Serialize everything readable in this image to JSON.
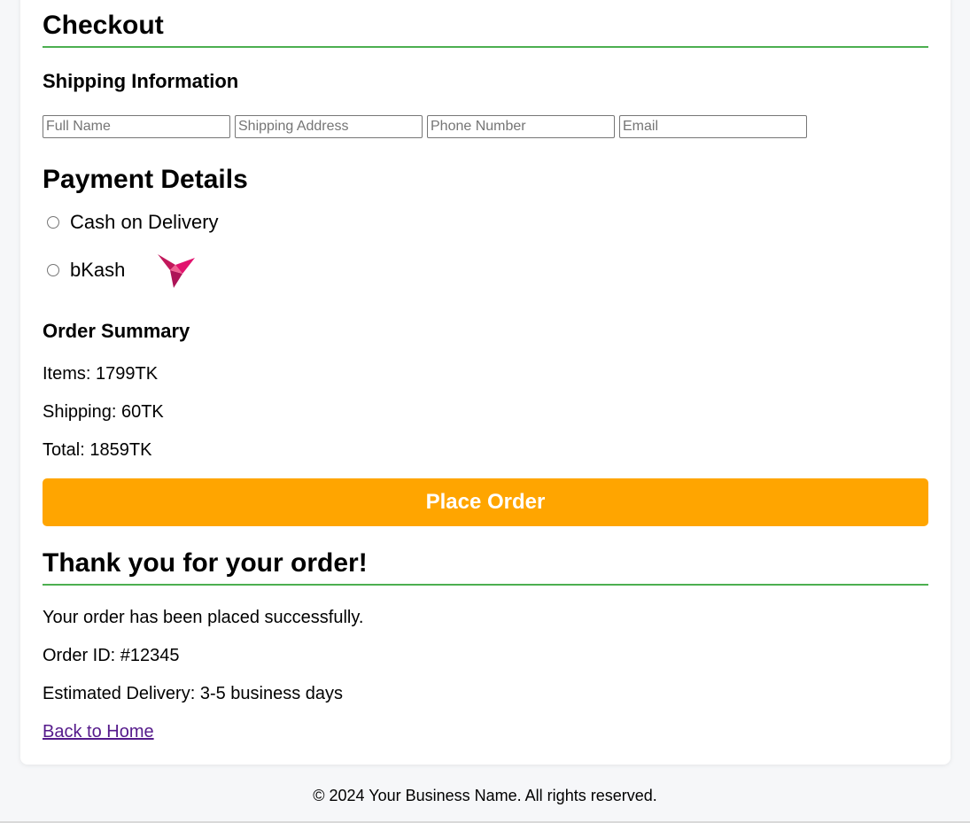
{
  "checkout": {
    "title": "Checkout"
  },
  "shipping": {
    "heading": "Shipping Information",
    "fields": [
      {
        "placeholder": "Full Name",
        "value": ""
      },
      {
        "placeholder": "Shipping Address",
        "value": ""
      },
      {
        "placeholder": "Phone Number",
        "value": ""
      },
      {
        "placeholder": "Email",
        "value": ""
      }
    ]
  },
  "payment": {
    "heading": "Payment Details",
    "options": [
      {
        "label": "Cash on Delivery",
        "selected": false
      },
      {
        "label": "bKash",
        "selected": false,
        "icon": "bkash-bird-logo"
      }
    ],
    "bkash_color": "#e2136e"
  },
  "summary": {
    "heading": "Order Summary",
    "items": "Items: 1799TK",
    "shipping": "Shipping: 60TK",
    "total": "Total: 1859TK"
  },
  "place_order": {
    "label": "Place Order",
    "color": "#ffa500"
  },
  "confirmation": {
    "heading": "Thank you for your order!",
    "message": "Your order has been placed successfully.",
    "order_id": "Order ID: #12345",
    "delivery": "Estimated Delivery: 3-5 business days",
    "back_link": "Back to Home"
  },
  "footer": {
    "text": "© 2024 Your Business Name. All rights reserved."
  },
  "colors": {
    "accent_rule": "#4caf50",
    "link": "#551a8b"
  }
}
